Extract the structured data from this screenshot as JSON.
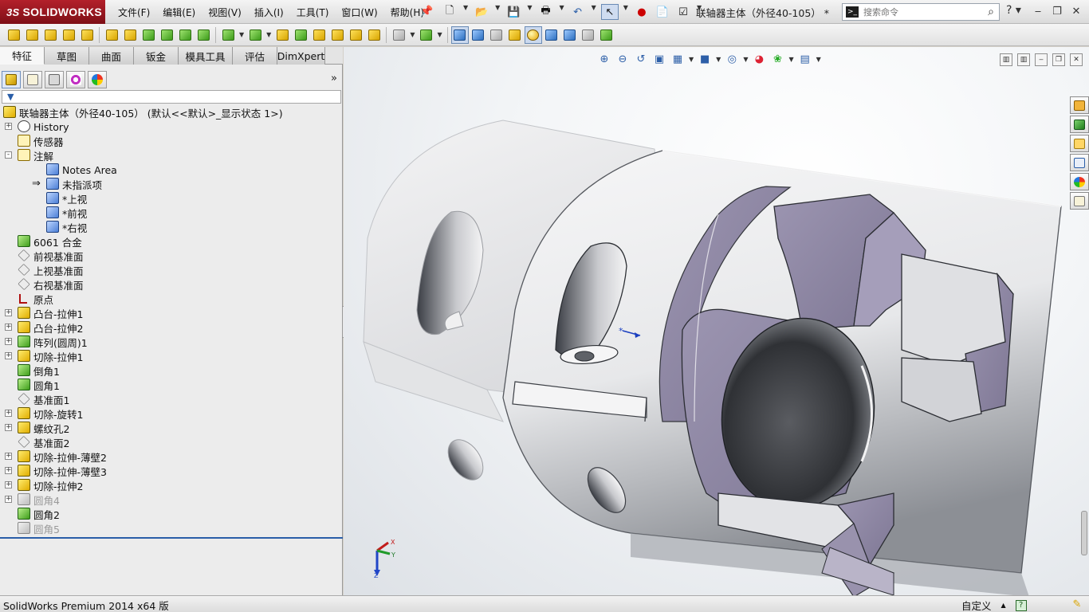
{
  "app": {
    "logo_prefix": "3S",
    "logo_text": "SOLIDWORKS",
    "document_title": "联轴器主体（外径40-105） *",
    "search_placeholder": "搜索命令"
  },
  "menu": [
    "文件(F)",
    "编辑(E)",
    "视图(V)",
    "插入(I)",
    "工具(T)",
    "窗口(W)",
    "帮助(H)"
  ],
  "panel_tabs": [
    "特征",
    "草图",
    "曲面",
    "钣金",
    "模具工具",
    "评估",
    "DimXpert"
  ],
  "feature_tree": {
    "root_label": "联轴器主体（外径40-105）  (默认<<默认>_显示状态 1>)",
    "items": [
      {
        "label": "History",
        "icon": "history-icon",
        "expander": "+",
        "indent": 0,
        "dim": false
      },
      {
        "label": "传感器",
        "icon": "sensor-icon",
        "expander": "",
        "indent": 0,
        "dim": false
      },
      {
        "label": "注解",
        "icon": "annotations-icon",
        "expander": "-",
        "indent": 0,
        "dim": false
      },
      {
        "label": "Notes Area",
        "icon": "notes-area-icon",
        "expander": "",
        "indent": 1,
        "dim": false
      },
      {
        "label": "未指派项",
        "icon": "unassigned-items-icon",
        "expander": "",
        "indent": 1,
        "dim": false
      },
      {
        "label": "*上视",
        "icon": "annotation-view-icon",
        "expander": "",
        "indent": 1,
        "dim": false
      },
      {
        "label": "*前视",
        "icon": "annotation-view-icon",
        "expander": "",
        "indent": 1,
        "dim": false
      },
      {
        "label": "*右视",
        "icon": "annotation-view-icon",
        "expander": "",
        "indent": 1,
        "dim": false
      },
      {
        "label": "6061 合金",
        "icon": "material-icon",
        "expander": "",
        "indent": 0,
        "dim": false
      },
      {
        "label": "前视基准面",
        "icon": "plane-icon",
        "expander": "",
        "indent": 0,
        "dim": false
      },
      {
        "label": "上视基准面",
        "icon": "plane-icon",
        "expander": "",
        "indent": 0,
        "dim": false
      },
      {
        "label": "右视基准面",
        "icon": "plane-icon",
        "expander": "",
        "indent": 0,
        "dim": false
      },
      {
        "label": "原点",
        "icon": "origin-icon",
        "expander": "",
        "indent": 0,
        "dim": false
      },
      {
        "label": "凸台-拉伸1",
        "icon": "boss-extrude-icon",
        "expander": "+",
        "indent": 0,
        "dim": false
      },
      {
        "label": "凸台-拉伸2",
        "icon": "boss-extrude-icon",
        "expander": "+",
        "indent": 0,
        "dim": false
      },
      {
        "label": "阵列(圆周)1",
        "icon": "circular-pattern-icon",
        "expander": "+",
        "indent": 0,
        "dim": false
      },
      {
        "label": "切除-拉伸1",
        "icon": "cut-extrude-icon",
        "expander": "+",
        "indent": 0,
        "dim": false
      },
      {
        "label": "倒角1",
        "icon": "chamfer-icon",
        "expander": "",
        "indent": 0,
        "dim": false
      },
      {
        "label": "圆角1",
        "icon": "fillet-icon",
        "expander": "",
        "indent": 0,
        "dim": false
      },
      {
        "label": "基准面1",
        "icon": "plane-icon",
        "expander": "",
        "indent": 0,
        "dim": false
      },
      {
        "label": "切除-旋转1",
        "icon": "cut-revolve-icon",
        "expander": "+",
        "indent": 0,
        "dim": false
      },
      {
        "label": "螺纹孔2",
        "icon": "hole-wizard-icon",
        "expander": "+",
        "indent": 0,
        "dim": false
      },
      {
        "label": "基准面2",
        "icon": "plane-icon",
        "expander": "",
        "indent": 0,
        "dim": false
      },
      {
        "label": "切除-拉伸-薄壁2",
        "icon": "cut-extrude-thin-icon",
        "expander": "+",
        "indent": 0,
        "dim": false
      },
      {
        "label": "切除-拉伸-薄壁3",
        "icon": "cut-extrude-thin-icon",
        "expander": "+",
        "indent": 0,
        "dim": false
      },
      {
        "label": "切除-拉伸2",
        "icon": "cut-extrude-icon",
        "expander": "+",
        "indent": 0,
        "dim": false
      },
      {
        "label": "圆角4",
        "icon": "fillet-icon",
        "expander": "+",
        "indent": 0,
        "dim": true
      },
      {
        "label": "圆角2",
        "icon": "fillet-icon",
        "expander": "",
        "indent": 0,
        "dim": false
      },
      {
        "label": "圆角5",
        "icon": "fillet-icon",
        "expander": "",
        "indent": 0,
        "dim": true
      }
    ]
  },
  "triad": {
    "x": "Y",
    "y": "X",
    "z": "Z"
  },
  "statusbar": {
    "product": "SolidWorks Premium 2014 x64 版",
    "units": "自定义",
    "help": "?"
  },
  "colors": {
    "part_body": "#e9eaec",
    "part_shadow": "#8f9298",
    "cut_face": "#8f87a4",
    "bore": "#3a3c40",
    "accent": "#2a5ea8",
    "brand": "#a0161f"
  }
}
